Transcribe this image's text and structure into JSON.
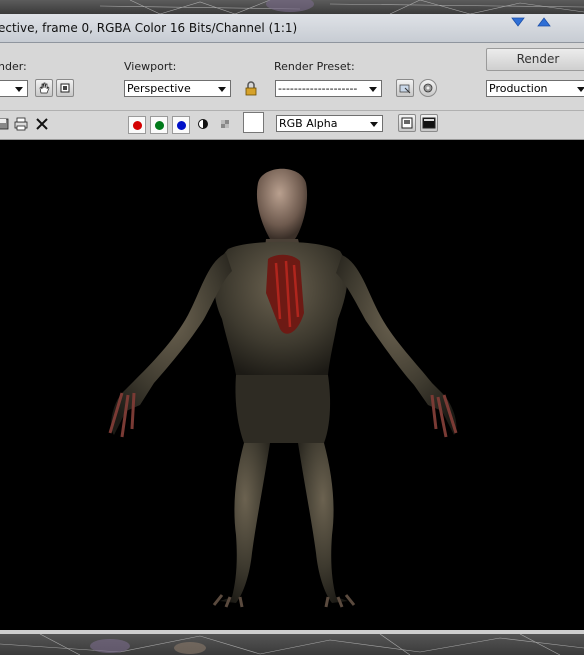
{
  "window": {
    "title": "ective, frame 0, RGBA Color 16 Bits/Channel (1:1)"
  },
  "toolbar": {
    "area_label": "nder:",
    "viewport_label": "Viewport:",
    "viewport_value": "Perspective",
    "preset_label": "Render Preset:",
    "preset_value": "--------------------",
    "render_button": "Render",
    "mode_value": "Production",
    "channel_value": "RGB Alpha"
  },
  "channels": {
    "red": "#d40000",
    "green": "#007a1a",
    "blue": "#0010c8"
  },
  "icons": [
    "pan-hand-icon",
    "region-icon",
    "lock-icon",
    "environment-icon",
    "settings-icon",
    "save-image-icon",
    "print-icon",
    "clear-icon",
    "mono-icon",
    "alpha-checker-icon",
    "display-toggle-icon",
    "frame-window-icon"
  ],
  "viewport": {
    "background": "#000000"
  }
}
